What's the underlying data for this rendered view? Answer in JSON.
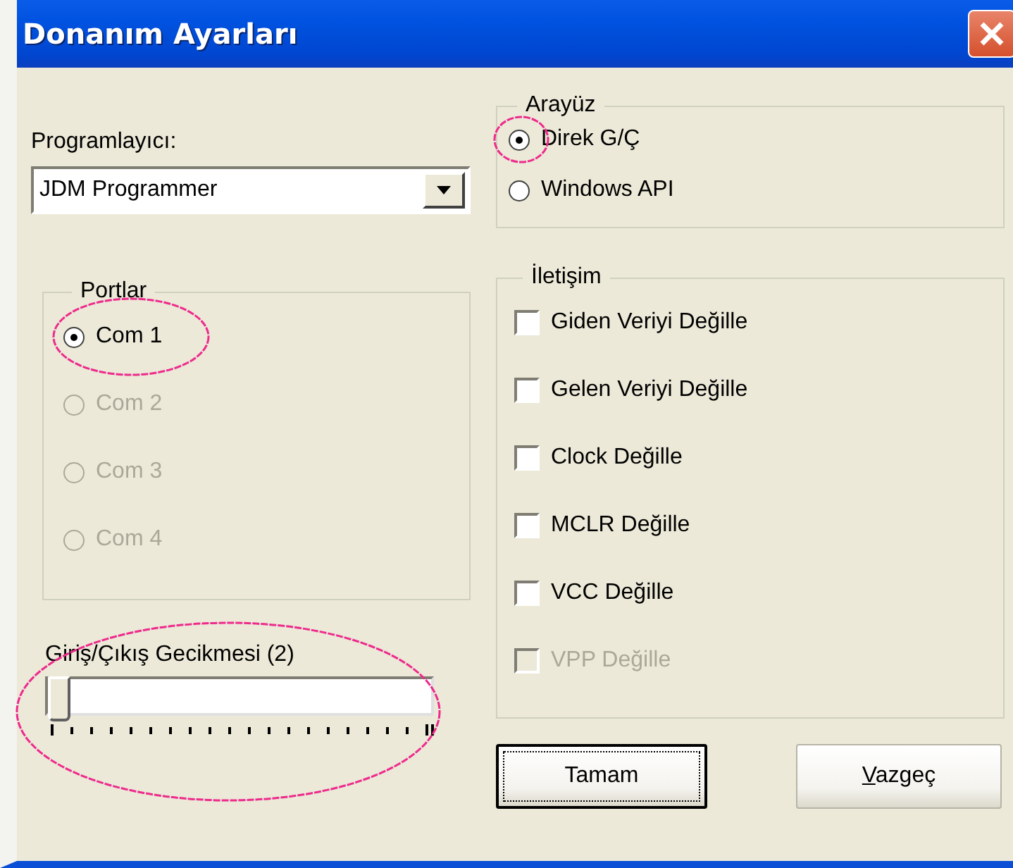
{
  "window": {
    "title": "Donanım Ayarları"
  },
  "programmer": {
    "label": "Programlayıcı:",
    "value": "JDM Programmer"
  },
  "interface_group": {
    "title": "Arayüz",
    "options": [
      {
        "label": "Direk G/Ç",
        "selected": true,
        "disabled": false,
        "highlighted": true
      },
      {
        "label": "Windows API",
        "selected": false,
        "disabled": false,
        "highlighted": false
      }
    ]
  },
  "ports_group": {
    "title": "Portlar",
    "options": [
      {
        "label": "Com 1",
        "selected": true,
        "disabled": false,
        "highlighted": true
      },
      {
        "label": "Com 2",
        "selected": false,
        "disabled": true,
        "highlighted": false
      },
      {
        "label": "Com 3",
        "selected": false,
        "disabled": true,
        "highlighted": false
      },
      {
        "label": "Com 4",
        "selected": false,
        "disabled": true,
        "highlighted": false
      }
    ]
  },
  "delay_slider": {
    "label": "Giriş/Çıkış Gecikmesi (2)",
    "level": 0,
    "highlighted": true
  },
  "communication_group": {
    "title": "İletişim",
    "options": [
      {
        "label": "Giden Veriyi Değille",
        "checked": false,
        "disabled": false
      },
      {
        "label": "Gelen Veriyi Değille",
        "checked": false,
        "disabled": false
      },
      {
        "label": "Clock Değille",
        "checked": false,
        "disabled": false
      },
      {
        "label": "MCLR Değille",
        "checked": false,
        "disabled": false
      },
      {
        "label": "VCC Değille",
        "checked": false,
        "disabled": false
      },
      {
        "label": "VPP Değille",
        "checked": false,
        "disabled": true
      }
    ]
  },
  "buttons": [
    {
      "label": "Tamam",
      "default": true,
      "mnemonic_underlined": false
    },
    {
      "label": "Vazgeç",
      "default": false,
      "mnemonic_underlined": true
    }
  ]
}
